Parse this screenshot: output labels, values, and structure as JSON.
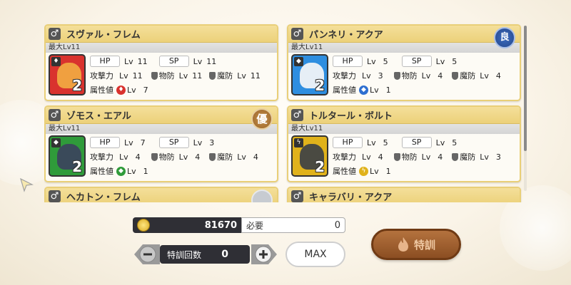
{
  "colors": {
    "card_header": "#ecd17a",
    "card_border": "#e9cf78",
    "fire": "#d9322e",
    "aqua": "#2e6fd0",
    "wind": "#2f9b3a",
    "thunder": "#e0b21b",
    "train_button": "#9b5c2c"
  },
  "cards": [
    {
      "name": "スヴァル・フレム",
      "max_level": "最大Lv11",
      "rank": "2",
      "element": "fire",
      "badge": "",
      "hp_label": "HP",
      "hp_lv": "Lv",
      "hp": "11",
      "sp_label": "SP",
      "sp_lv": "Lv",
      "sp": "11",
      "atk_label": "攻撃力",
      "atk_lv": "Lv",
      "atk": "11",
      "pdef_label": "物防",
      "pdef_lv": "Lv",
      "pdef": "11",
      "mdef_label": "魔防",
      "mdef_lv": "Lv",
      "mdef": "11",
      "attr_label": "属性値",
      "attr_lv": "Lv",
      "attr": "7"
    },
    {
      "name": "パンネリ・アクア",
      "max_level": "最大Lv11",
      "rank": "2",
      "element": "aqua",
      "badge": "良",
      "hp_label": "HP",
      "hp_lv": "Lv",
      "hp": "5",
      "sp_label": "SP",
      "sp_lv": "Lv",
      "sp": "5",
      "atk_label": "攻撃力",
      "atk_lv": "Lv",
      "atk": "3",
      "pdef_label": "物防",
      "pdef_lv": "Lv",
      "pdef": "4",
      "mdef_label": "魔防",
      "mdef_lv": "Lv",
      "mdef": "4",
      "attr_label": "属性値",
      "attr_lv": "Lv",
      "attr": "1"
    },
    {
      "name": "ゾモス・エアル",
      "max_level": "最大Lv11",
      "rank": "2",
      "element": "wind",
      "badge": "優",
      "hp_label": "HP",
      "hp_lv": "Lv",
      "hp": "7",
      "sp_label": "SP",
      "sp_lv": "Lv",
      "sp": "3",
      "atk_label": "攻撃力",
      "atk_lv": "Lv",
      "atk": "4",
      "pdef_label": "物防",
      "pdef_lv": "Lv",
      "pdef": "4",
      "mdef_label": "魔防",
      "mdef_lv": "Lv",
      "mdef": "4",
      "attr_label": "属性値",
      "attr_lv": "Lv",
      "attr": "1"
    },
    {
      "name": "トルタール・ボルト",
      "max_level": "最大Lv11",
      "rank": "2",
      "element": "thunder",
      "badge": "",
      "hp_label": "HP",
      "hp_lv": "Lv",
      "hp": "5",
      "sp_label": "SP",
      "sp_lv": "Lv",
      "sp": "5",
      "atk_label": "攻撃力",
      "atk_lv": "Lv",
      "atk": "4",
      "pdef_label": "物防",
      "pdef_lv": "Lv",
      "pdef": "4",
      "mdef_label": "魔防",
      "mdef_lv": "Lv",
      "mdef": "3",
      "attr_label": "属性値",
      "attr_lv": "Lv",
      "attr": "1"
    },
    {
      "name": "ヘカトン・フレム",
      "partial": true
    },
    {
      "name": "キャラバリ・アクア",
      "partial": true
    }
  ],
  "gender_symbol": "♂",
  "currency": {
    "amount": "81670",
    "need_label": "必要",
    "need_value": "0"
  },
  "training": {
    "count_label": "特訓回数",
    "count_value": "0",
    "minus": "−",
    "plus": "+",
    "max_label": "MAX",
    "train_label": "特訓"
  }
}
